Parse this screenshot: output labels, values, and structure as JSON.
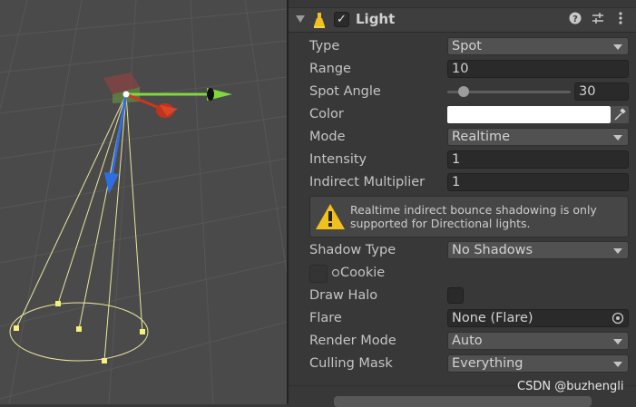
{
  "component": {
    "title": "Light",
    "enabled": true,
    "header_icons": [
      "help-icon",
      "presets-icon",
      "more-icon"
    ]
  },
  "fields": {
    "type": {
      "label": "Type",
      "value": "Spot"
    },
    "range": {
      "label": "Range",
      "value": "10"
    },
    "spot_angle": {
      "label": "Spot Angle",
      "value": "30",
      "slider_fraction": 0.13
    },
    "color": {
      "label": "Color",
      "value": "#ffffff"
    },
    "mode": {
      "label": "Mode",
      "value": "Realtime"
    },
    "intensity": {
      "label": "Intensity",
      "value": "1"
    },
    "indirect_multiplier": {
      "label": "Indirect Multiplier",
      "value": "1"
    },
    "shadow_type": {
      "label": "Shadow Type",
      "value": "No Shadows"
    },
    "cookie": {
      "label": "Cookie"
    },
    "draw_halo": {
      "label": "Draw Halo",
      "checked": false
    },
    "flare": {
      "label": "Flare",
      "value": "None (Flare)"
    },
    "render_mode": {
      "label": "Render Mode",
      "value": "Auto"
    },
    "culling_mask": {
      "label": "Culling Mask",
      "value": "Everything"
    }
  },
  "help_box": {
    "line1": "Realtime indirect bounce shadowing is only",
    "line2": "supported for Directional lights."
  },
  "watermark": "CSDN @buzhengli",
  "colors": {
    "gizmo_x": "#d0351f",
    "gizmo_y": "#7fd93b",
    "gizmo_z": "#2f6ee0",
    "spot_gizmo": "#e9e6a0",
    "warning": "#f2c01d"
  }
}
